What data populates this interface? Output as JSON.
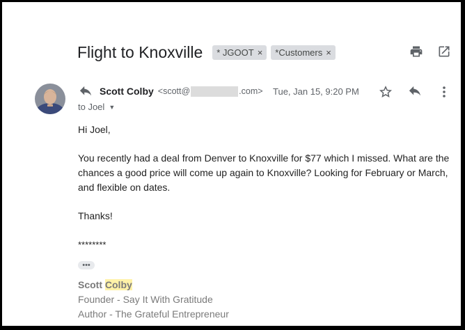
{
  "thread": {
    "subject": "Flight to Knoxville",
    "labels": [
      {
        "name": "* JGOOT",
        "remove": "×"
      },
      {
        "name": "*Customers",
        "remove": "×"
      }
    ]
  },
  "message": {
    "sender_name": "Scott Colby",
    "sender_email_prefix": "<scott@",
    "sender_email_suffix": ".com>",
    "date": "Tue, Jan 15, 9:20 PM",
    "to": "to Joel",
    "body": {
      "greeting": "Hi Joel,",
      "paragraph": "You recently had a deal from Denver to Knoxville for $77 which I missed.  What are the chances a good price will come up again to Knoxville?  Looking for February or March, and flexible on dates.",
      "thanks": "Thanks!",
      "stars": "********"
    },
    "trimmed_label": "•••",
    "signature": {
      "first": "Scott ",
      "last": "Colby",
      "line1": "Founder - Say It With Gratitude",
      "line2": "Author - The Grateful Entrepreneur"
    }
  },
  "icons": [
    "print-icon",
    "open-in-new-icon",
    "reply-icon",
    "star-icon",
    "more-vert-icon",
    "caret-down-icon"
  ]
}
